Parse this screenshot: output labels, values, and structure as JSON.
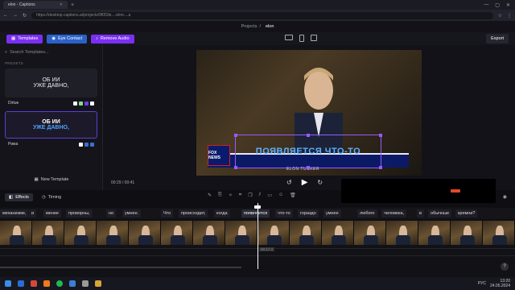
{
  "browser": {
    "tab_title": "elon - Captions",
    "url": "https://desktop.captions.ai/projects/9f053e...-elon-...a"
  },
  "app": {
    "breadcrumb_parent": "Projects",
    "breadcrumb_sep": "/",
    "breadcrumb_current": "elon",
    "export_label": "Export"
  },
  "toolbar": {
    "templates": "Templates",
    "eye_contact": "Eye Contact",
    "remove_audio": "Remove Audio"
  },
  "left_panel": {
    "search_placeholder": "Search Templates...",
    "presets_label": "PRESETS",
    "cards": [
      {
        "line1": "ОБ ИИ",
        "line2": "УЖЕ ДАВНО,",
        "name": "Dirtue",
        "swatches": [
          "#ffffff",
          "#7fe08a",
          "#6b3cf0",
          "#ffffff"
        ]
      },
      {
        "line1": "ОБ ИИ",
        "line2": "УЖЕ ДАВНО,",
        "name": "Рижа",
        "swatches": [
          "#ffffff",
          "#3b6fd8",
          "#3b6fd8"
        ]
      }
    ],
    "new_template": "New Template"
  },
  "video": {
    "caption_text": "ПОЯВЛЯЕТСЯ ЧТО-ТО",
    "channel_logo": "FOX NEWS",
    "nameplate": "ELON   TUCKER"
  },
  "player": {
    "time": "00:29 / 00:41"
  },
  "editor_tabs": {
    "effects": "Effects",
    "timing": "Timing"
  },
  "words": [
    {
      "text": "механизме,"
    },
    {
      "text": "и"
    },
    {
      "text": "менее"
    },
    {
      "text": "проворны,"
    },
    {
      "text": "но"
    },
    {
      "text": "умнее."
    },
    {
      "text": "Что"
    },
    {
      "text": "происходит,"
    },
    {
      "text": "когда"
    },
    {
      "text": "появляется"
    },
    {
      "text": "что-то"
    },
    {
      "text": "гораздо"
    },
    {
      "text": "умнее"
    },
    {
      "text": "любого"
    },
    {
      "text": "человека,"
    },
    {
      "text": "в"
    },
    {
      "text": "обычные"
    },
    {
      "text": "кремни?"
    }
  ],
  "timeline": {
    "playhead_label": "00:17.3",
    "help": "?"
  },
  "taskbar": {
    "lang": "РУС",
    "time": "13:20",
    "date": "24.05.2024"
  }
}
